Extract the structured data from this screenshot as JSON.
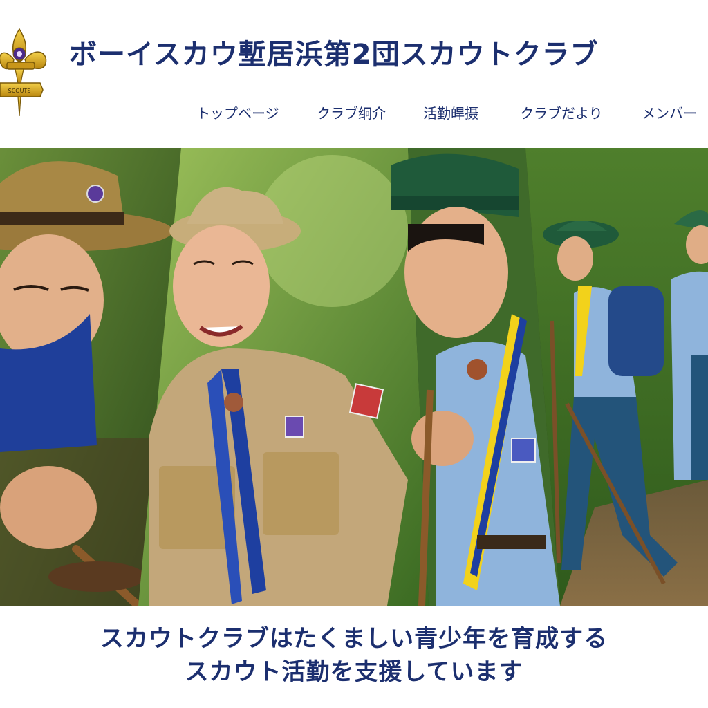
{
  "site": {
    "title": "ボーイスカウ塹居浜第2団スカウトクラブ",
    "logo_icon": "fleur-de-lis-emblem-icon",
    "logo_text": "SCOUTS"
  },
  "nav": {
    "items": [
      {
        "label": "トップベージ"
      },
      {
        "label": "クラブ䌹介"
      },
      {
        "label": "活勤皔摄"
      },
      {
        "label": "クラブだより"
      },
      {
        "label": "メンバー"
      }
    ]
  },
  "hero": {
    "panels": [
      "scout-working-with-stick",
      "smiling-scout-leader",
      "scout-boy-with-scarf",
      "scouts-hiking-trail"
    ]
  },
  "tagline": {
    "line1": "スカウトクラブはたくましい青少年を育成する",
    "line2": "スカウト活勤を支援しています"
  },
  "colors": {
    "brand_navy": "#1c2f6f",
    "scarf_blue": "#1e3fa0",
    "scarf_yellow": "#f2d21b",
    "emblem_gold": "#d4a317"
  }
}
